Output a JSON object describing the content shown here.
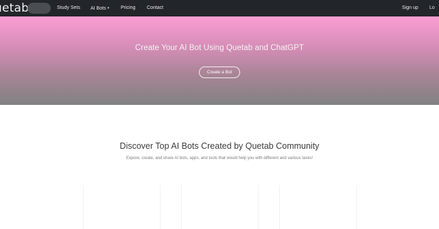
{
  "navbar": {
    "brand": "uetab",
    "links": {
      "study_sets": "Study Sets",
      "ai_bots": "AI Bots",
      "pricing": "Pricing",
      "contact": "Contact",
      "sign_up": "Sign up",
      "login": "Lo"
    },
    "ai_bots_caret": "▾"
  },
  "hero": {
    "title": "Create Your AI Bot Using Quetab and ChatGPT",
    "button": "Create a Bot"
  },
  "discover": {
    "title": "Discover Top AI Bots Created by Quetab Community",
    "subtitle": "Expore, create, and share AI bots, apps, and tools that would help you with different and various tasks!"
  },
  "colors": {
    "navbar_bg": "#222529",
    "hero_top": "#fb9dd3",
    "hero_bottom": "#818181",
    "title_text": "#3b3b3b"
  }
}
